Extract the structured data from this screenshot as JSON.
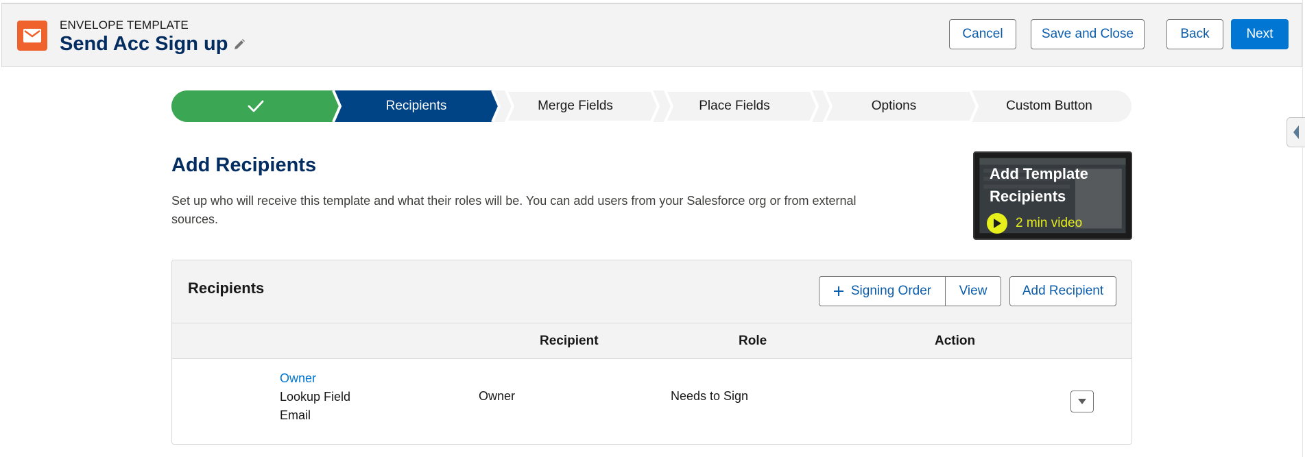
{
  "header": {
    "eyebrow": "ENVELOPE TEMPLATE",
    "title": "Send Acc Sign up",
    "icon": "envelope-icon",
    "buttons": {
      "cancel": "Cancel",
      "save_close": "Save and Close",
      "back": "Back",
      "next": "Next"
    }
  },
  "path": {
    "stages": [
      {
        "label": "",
        "state": "complete",
        "icon": "check-icon"
      },
      {
        "label": "Recipients",
        "state": "current"
      },
      {
        "label": "Merge Fields",
        "state": "incomplete"
      },
      {
        "label": "Place Fields",
        "state": "incomplete"
      },
      {
        "label": "Options",
        "state": "incomplete"
      },
      {
        "label": "Custom Button",
        "state": "incomplete"
      }
    ]
  },
  "intro": {
    "heading": "Add Recipients",
    "description": "Set up who will receive this template and what their roles will be. You can add users from your Salesforce org or from external sources."
  },
  "video": {
    "title": "Add Template Recipients",
    "duration": "2 min video"
  },
  "recipients_card": {
    "title": "Recipients",
    "signing_order": "Signing Order",
    "view": "View",
    "add_recipient": "Add Recipient",
    "columns": [
      "Recipient",
      "Role",
      "Action"
    ],
    "rows": [
      {
        "name": "Owner",
        "source_line1": "Lookup Field",
        "source_line2": "Email",
        "recipient": "Owner",
        "role": "Needs to Sign"
      }
    ]
  },
  "colors": {
    "brand": "#0176d3",
    "path_complete": "#3ba755",
    "path_current": "#014486",
    "title_navy": "#032d60",
    "app_icon": "#f0622d",
    "video_accent": "#e6ef1c"
  }
}
